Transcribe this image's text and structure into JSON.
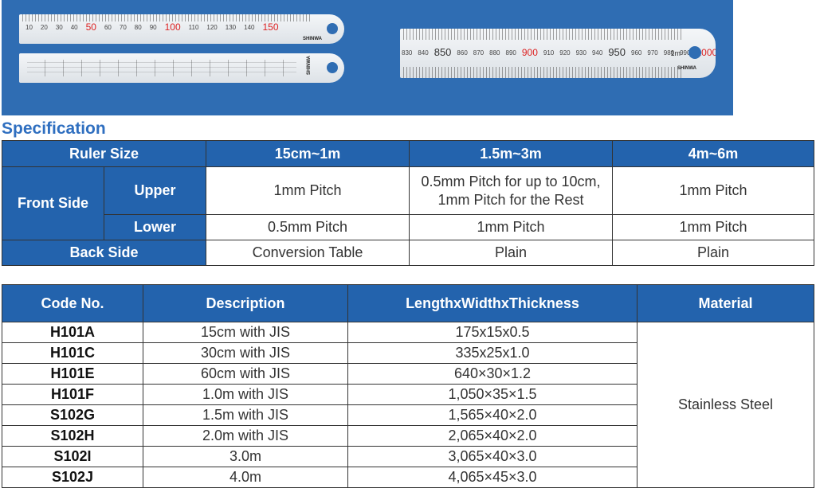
{
  "banner": {
    "ruler1": {
      "numbers": [
        "10",
        "20",
        "30",
        "40",
        "50",
        "60",
        "70",
        "80",
        "90",
        "100",
        "110",
        "120",
        "130",
        "140",
        "150"
      ],
      "red": [
        "50",
        "100",
        "150"
      ],
      "brand": "SHINWA"
    },
    "ruler3": {
      "numbers": [
        "830",
        "840",
        "850",
        "860",
        "870",
        "880",
        "890",
        "900",
        "910",
        "920",
        "930",
        "940",
        "950",
        "960",
        "970",
        "980",
        "990",
        "1000"
      ],
      "red": [
        "900",
        "1000"
      ],
      "big": [
        "850",
        "950"
      ],
      "unit": "1m",
      "brand": "SHINWA"
    }
  },
  "heading": "Specification",
  "spec_table": {
    "header": {
      "ruler_size": "Ruler Size",
      "col1": "15cm~1m",
      "col2": "1.5m~3m",
      "col3": "4m~6m"
    },
    "front_side": "Front Side",
    "upper": {
      "label": "Upper",
      "col1": "1mm Pitch",
      "col2_line1": "0.5mm Pitch for up to 10cm,",
      "col2_line2": "1mm Pitch for the Rest",
      "col3": "1mm Pitch"
    },
    "lower": {
      "label": "Lower",
      "col1": "0.5mm Pitch",
      "col2": "1mm Pitch",
      "col3": "1mm Pitch"
    },
    "back": {
      "label": "Back Side",
      "col1": "Conversion Table",
      "col2": "Plain",
      "col3": "Plain"
    }
  },
  "code_table": {
    "headers": {
      "code": "Code No.",
      "description": "Description",
      "dimensions": "LengthxWidthxThickness",
      "material": "Material"
    },
    "material_value": "Stainless Steel",
    "rows": [
      {
        "code": "H101A",
        "description": "15cm with JIS",
        "dimensions": "175x15x0.5"
      },
      {
        "code": "H101C",
        "description": "30cm with JIS",
        "dimensions": "335x25x1.0"
      },
      {
        "code": "H101E",
        "description": "60cm with JIS",
        "dimensions": "640×30×1.2"
      },
      {
        "code": "H101F",
        "description": "1.0m with JIS",
        "dimensions": "1,050×35×1.5"
      },
      {
        "code": "S102G",
        "description": "1.5m with JIS",
        "dimensions": "1,565×40×2.0"
      },
      {
        "code": "S102H",
        "description": "2.0m with JIS",
        "dimensions": "2,065×40×2.0"
      },
      {
        "code": "S102I",
        "description": "3.0m",
        "dimensions": "3,065×40×3.0"
      },
      {
        "code": "S102J",
        "description": "4.0m",
        "dimensions": "4,065×45×3.0"
      }
    ]
  }
}
